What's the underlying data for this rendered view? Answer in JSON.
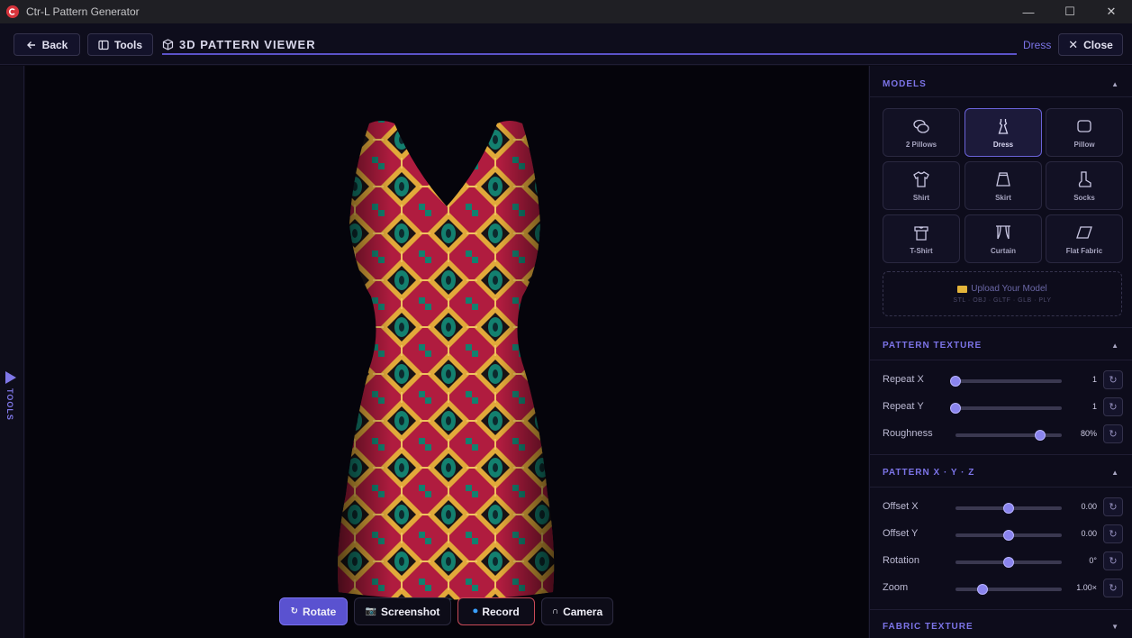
{
  "window": {
    "title": "Ctr-L Pattern Generator",
    "min": "—",
    "max": "☐",
    "close": "✕"
  },
  "header": {
    "back_label": "Back",
    "tools_label": "Tools",
    "title": "3D PATTERN VIEWER",
    "model_name": "Dress",
    "close_label": "Close"
  },
  "tools_strip": {
    "label": "TOOLS"
  },
  "viewport": {
    "buttons": [
      {
        "icon": "↻",
        "label": "Rotate"
      },
      {
        "icon": "📷",
        "label": "Screenshot"
      },
      {
        "icon": "⏺",
        "label": "Record"
      },
      {
        "icon": "∩",
        "label": "Camera"
      }
    ]
  },
  "panel": {
    "models": {
      "title": "MODELS",
      "items": [
        {
          "label": "2 Pillows",
          "icon": "pillows-icon",
          "active": false
        },
        {
          "label": "Dress",
          "icon": "dress-icon",
          "active": true
        },
        {
          "label": "Pillow",
          "icon": "pillow-icon",
          "active": false
        },
        {
          "label": "Shirt",
          "icon": "shirt-icon",
          "active": false
        },
        {
          "label": "Skirt",
          "icon": "skirt-icon",
          "active": false
        },
        {
          "label": "Socks",
          "icon": "socks-icon",
          "active": false
        },
        {
          "label": "T-Shirt",
          "icon": "tshirt-icon",
          "active": false
        },
        {
          "label": "Curtain",
          "icon": "curtain-icon",
          "active": false
        },
        {
          "label": "Flat Fabric",
          "icon": "flat-fabric-icon",
          "active": false
        }
      ],
      "upload_label": "Upload Your Model",
      "upload_formats": "STL · OBJ · GLTF · GLB · PLY"
    },
    "pattern_texture": {
      "title": "PATTERN TEXTURE",
      "controls": [
        {
          "label": "Repeat X",
          "value": "1",
          "fraction": 0.0
        },
        {
          "label": "Repeat Y",
          "value": "1",
          "fraction": 0.0
        },
        {
          "label": "Roughness",
          "value": "80%",
          "fraction": 0.8
        }
      ]
    },
    "pattern_xyz": {
      "title": "PATTERN X · Y · Z",
      "controls": [
        {
          "label": "Offset X",
          "value": "0.00",
          "fraction": 0.5
        },
        {
          "label": "Offset Y",
          "value": "0.00",
          "fraction": 0.5
        },
        {
          "label": "Rotation",
          "value": "0°",
          "fraction": 0.5
        },
        {
          "label": "Zoom",
          "value": "1.00×",
          "fraction": 0.25
        }
      ]
    },
    "fabric_texture": {
      "title": "FABRIC TEXTURE"
    }
  },
  "colors": {
    "accent": "#6a62d8",
    "record": "#e0394a"
  }
}
